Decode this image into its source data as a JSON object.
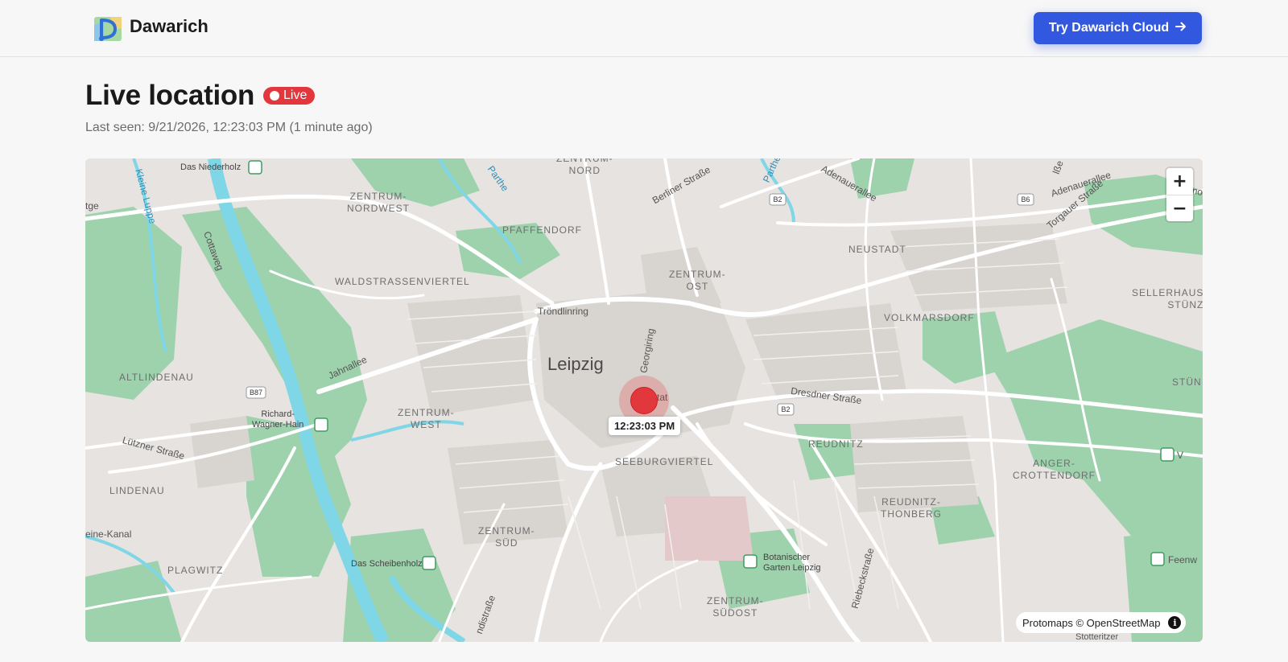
{
  "header": {
    "brand": "Dawarich",
    "cta_label": "Try Dawarich Cloud"
  },
  "page": {
    "title": "Live location",
    "badge": "Live",
    "last_seen": "Last seen: 9/21/2026, 12:23:03 PM (1 minute ago)"
  },
  "map": {
    "city": "Leipzig",
    "marker_time": "12:23:03 PM",
    "attribution": "Protomaps © OpenStreetMap",
    "zoom_in": "+",
    "zoom_out": "−",
    "districts": {
      "zentrum_nord": "ZENTRUM-\nNORD",
      "zentrum_nordwest": "ZENTRUM-\nNORDWEST",
      "pfaffendorf": "PFAFFENDORF",
      "waldstrassenviertel": "WALDSTRASSENVIERTEL",
      "zentrum_ost": "ZENTRUM-\nOST",
      "neustadt": "NEUSTADT",
      "volkmarsdorf": "VOLKMARSDORF",
      "sellerhausen": "SELLERHAUS\nSTÜNZ",
      "altlindenau": "ALTLINDENAU",
      "zentrum_west": "ZENTRUM-\nWEST",
      "reudnitz": "REUDNITZ",
      "anger_crottendorf": "ANGER-\nCROTTENDORF",
      "seeburgviertel": "SEEBURGVIERTEL",
      "lindenau": "LINDENAU",
      "reudnitz_thonberg": "REUDNITZ-\nTHONBERG",
      "zentrum_sued": "ZENTRUM-\nSÜD",
      "plagwitz": "PLAGWITZ",
      "zentrum_suedost": "ZENTRUM-\nSÜDOST",
      "stuen": "STÜN"
    },
    "streets": {
      "berliner": "Berliner Straße",
      "adenauerallee": "Adenauerallee",
      "adenauerallee2": "Adenauerallee",
      "torgauer": "Torgauer Straße",
      "troendlinring": "Tröndlinring",
      "jahnallee": "Jahnallee",
      "georgiring": "Georgiring",
      "dresdner": "Dresdner Straße",
      "luetzner": "Lützner Straße",
      "cottaweg": "Cottaweg",
      "riebeck": "Riebeckstraße",
      "kleine_luppe": "Kleine Luppe",
      "parthe": "Parthe",
      "parthe2": "Parthe",
      "etge": "tge",
      "kanal": "eine-Kanal",
      "permo": "Permo",
      "strasse": "ndistraße",
      "isse": "lße",
      "feenw": "Feenw",
      "stotteritzer": "Stotteritzer",
      "v": "V",
      "tat": "tat"
    },
    "parks": {
      "niederholz": "Das Niederholz",
      "richard_wagner": "Richard-\nWagner-Hain",
      "scheibenholz": "Das Scheibenholz",
      "botanischer": "Botanischer\nGarten Leipzig"
    },
    "road_shields": {
      "b2_top": "B2",
      "b6": "B6",
      "b87": "B87",
      "b2_mid": "B2"
    }
  },
  "colors": {
    "accent": "#3358e0",
    "live": "#e2373c",
    "park": "#9ed2ad",
    "water": "#7ed6e6",
    "land": "#e6e3e0",
    "road": "#ffffff"
  }
}
